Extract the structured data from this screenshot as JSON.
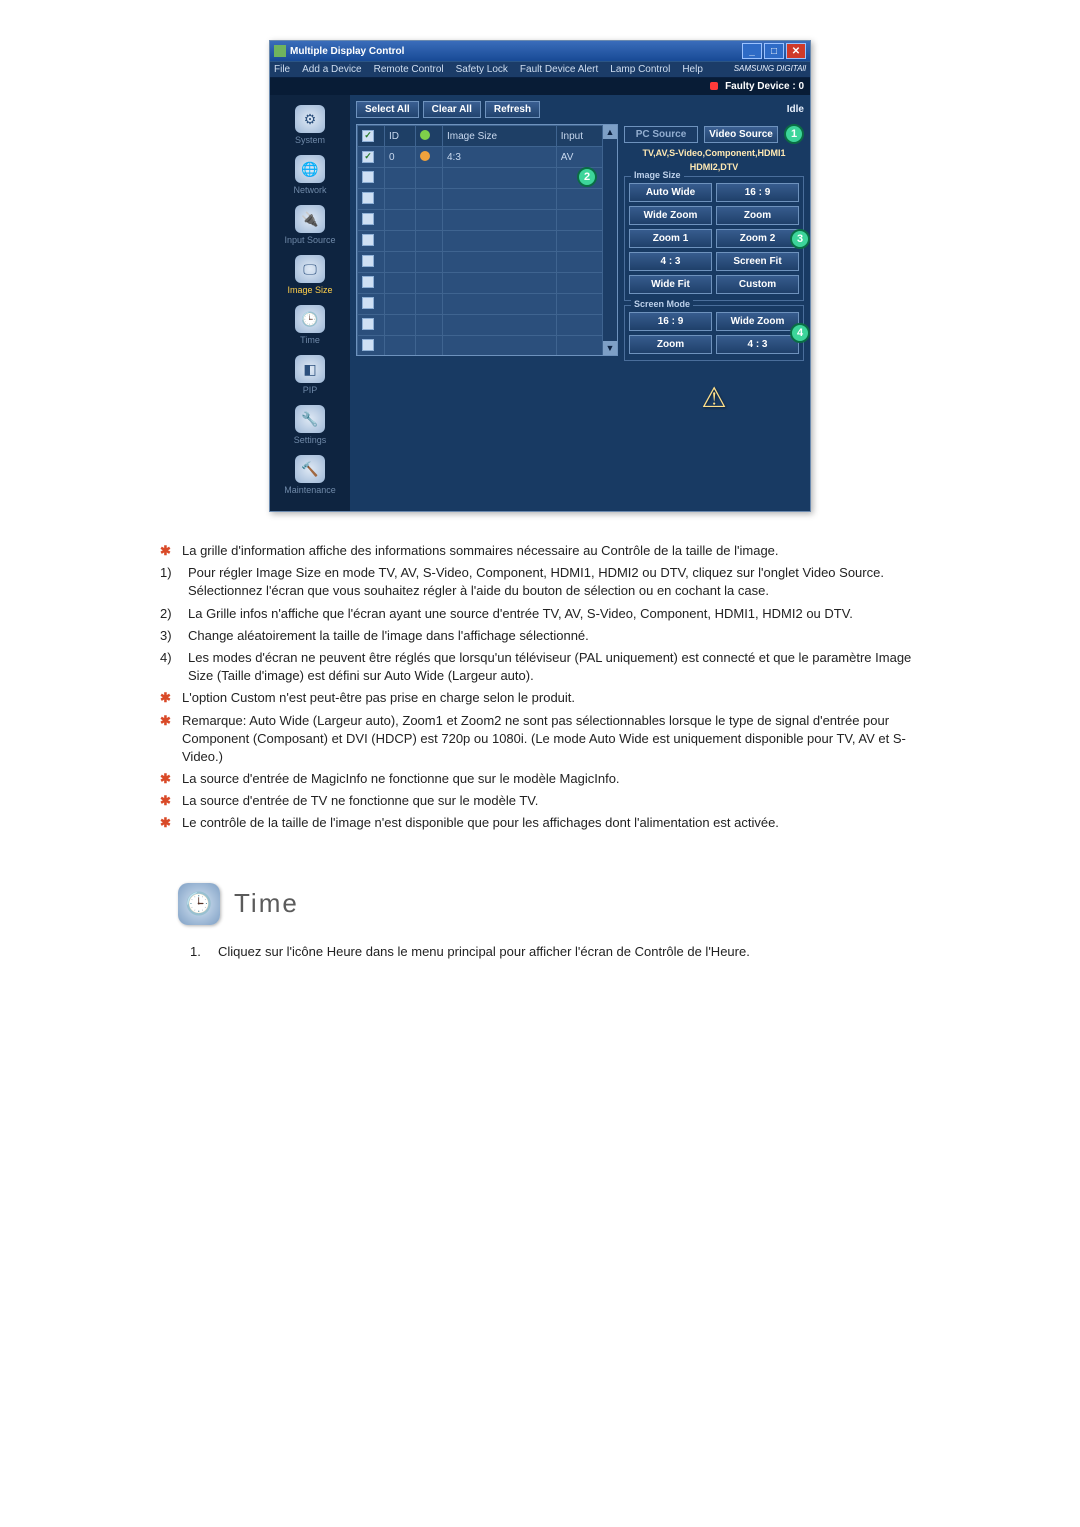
{
  "window": {
    "title": "Multiple Display Control",
    "menu": [
      "File",
      "Add a Device",
      "Remote Control",
      "Safety Lock",
      "Fault Device Alert",
      "Lamp Control",
      "Help"
    ],
    "brand": "SAMSUNG DIGITAll",
    "faulty_label": "Faulty Device : 0"
  },
  "toolbar": {
    "select_all": "Select All",
    "clear_all": "Clear All",
    "refresh": "Refresh",
    "idle": "Idle"
  },
  "sidebar": {
    "items": [
      {
        "label": "System"
      },
      {
        "label": "Network"
      },
      {
        "label": "Input Source"
      },
      {
        "label": "Image Size"
      },
      {
        "label": "Time"
      },
      {
        "label": "PIP"
      },
      {
        "label": "Settings"
      },
      {
        "label": "Maintenance"
      }
    ]
  },
  "grid": {
    "headers": {
      "chk": "",
      "id": "ID",
      "status": "",
      "imagesize": "Image Size",
      "input": "Input"
    },
    "rows": [
      {
        "checked": true,
        "id": "0",
        "status": "orange",
        "imagesize": "4:3",
        "input": "AV"
      },
      {
        "checked": false,
        "id": "",
        "status": "",
        "imagesize": "",
        "input": ""
      },
      {
        "checked": false,
        "id": "",
        "status": "",
        "imagesize": "",
        "input": ""
      },
      {
        "checked": false,
        "id": "",
        "status": "",
        "imagesize": "",
        "input": ""
      },
      {
        "checked": false,
        "id": "",
        "status": "",
        "imagesize": "",
        "input": ""
      },
      {
        "checked": false,
        "id": "",
        "status": "",
        "imagesize": "",
        "input": ""
      },
      {
        "checked": false,
        "id": "",
        "status": "",
        "imagesize": "",
        "input": ""
      },
      {
        "checked": false,
        "id": "",
        "status": "",
        "imagesize": "",
        "input": ""
      },
      {
        "checked": false,
        "id": "",
        "status": "",
        "imagesize": "",
        "input": ""
      },
      {
        "checked": false,
        "id": "",
        "status": "",
        "imagesize": "",
        "input": ""
      },
      {
        "checked": false,
        "id": "",
        "status": "",
        "imagesize": "",
        "input": ""
      },
      {
        "checked": false,
        "id": "",
        "status": "",
        "imagesize": "",
        "input": ""
      }
    ],
    "badge2": "2"
  },
  "right": {
    "tabs": {
      "pc": "PC Source",
      "video": "Video Source",
      "badge1": "1"
    },
    "source_line1": "TV,AV,S-Video,Component,HDMI1",
    "source_line2": "HDMI2,DTV",
    "image_size": {
      "legend": "Image Size",
      "options": [
        "Auto Wide",
        "16 : 9",
        "Wide Zoom",
        "Zoom",
        "Zoom 1",
        "Zoom 2",
        "4 : 3",
        "Screen Fit",
        "Wide Fit",
        "Custom"
      ],
      "badge3": "3"
    },
    "screen_mode": {
      "legend": "Screen Mode",
      "options": [
        "16 : 9",
        "Wide Zoom",
        "Zoom",
        "4 : 3"
      ],
      "badge4": "4"
    }
  },
  "notes": [
    {
      "kind": "star",
      "text": "La grille d'information affiche des informations sommaires nécessaire au Contrôle de la taille de l'image."
    },
    {
      "kind": "num",
      "n": "1)",
      "text": "Pour régler Image Size en mode TV, AV, S-Video, Component, HDMI1, HDMI2 ou DTV, cliquez sur l'onglet Video Source. Sélectionnez l'écran que vous souhaitez régler à l'aide du bouton de sélection ou en cochant la case."
    },
    {
      "kind": "num",
      "n": "2)",
      "text": "La Grille infos n'affiche que l'écran ayant une source d'entrée TV, AV, S-Video, Component, HDMI1, HDMI2 ou DTV."
    },
    {
      "kind": "num",
      "n": "3)",
      "text": "Change aléatoirement la taille de l'image dans l'affichage sélectionné."
    },
    {
      "kind": "num",
      "n": "4)",
      "text": "Les modes d'écran ne peuvent être réglés que lorsqu'un téléviseur (PAL uniquement) est connecté et que le paramètre Image Size (Taille d'image) est défini sur Auto Wide (Largeur auto)."
    },
    {
      "kind": "star",
      "text": "L'option Custom n'est peut-être pas prise en charge selon le produit."
    },
    {
      "kind": "star",
      "text": "Remarque: Auto Wide (Largeur auto), Zoom1 et Zoom2 ne sont pas sélectionnables lorsque le type de signal d'entrée pour Component (Composant) et DVI (HDCP) est 720p ou 1080i. (Le mode Auto Wide est uniquement disponible pour TV, AV et S-Video.)"
    },
    {
      "kind": "star",
      "text": "La source d'entrée de MagicInfo ne fonctionne que sur le modèle MagicInfo."
    },
    {
      "kind": "star",
      "text": "La source d'entrée de TV ne fonctionne que sur le modèle TV."
    },
    {
      "kind": "star",
      "text": "Le contrôle de la taille de l'image n'est disponible que pour les affichages dont l'alimentation est activée."
    }
  ],
  "time_section": {
    "title": "Time",
    "step1_n": "1.",
    "step1": "Cliquez sur l'icône Heure dans le menu principal pour afficher l'écran de Contrôle de l'Heure."
  }
}
